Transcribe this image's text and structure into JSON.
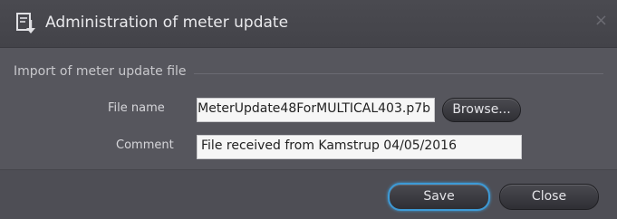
{
  "dialog": {
    "title": "Administration of meter update",
    "close_glyph": "×",
    "title_icon": "import-document-icon"
  },
  "group": {
    "label": "Import of meter update file"
  },
  "file_name": {
    "label": "File name",
    "value": "MeterUpdate48ForMULTICAL403.p7b"
  },
  "browse": {
    "label": "Browse..."
  },
  "comment": {
    "label": "Comment",
    "value": "File received from Kamstrup 04/05/2016"
  },
  "footer": {
    "save_label": "Save",
    "close_label": "Close"
  },
  "colors": {
    "accent": "#3d9ad6",
    "background": "#56565d"
  }
}
